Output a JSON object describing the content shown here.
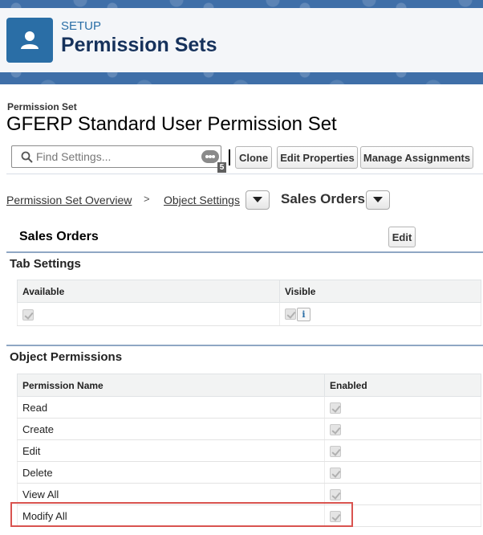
{
  "header": {
    "setup_label": "SETUP",
    "title": "Permission Sets",
    "icon": "user-icon"
  },
  "permission_set": {
    "caption": "Permission Set",
    "name": "GFERP Standard User Permission Set"
  },
  "toolbar": {
    "search_placeholder": "Find Settings...",
    "search_count": "5",
    "clone_label": "Clone",
    "edit_properties_label": "Edit Properties",
    "manage_assignments_label": "Manage Assignments"
  },
  "breadcrumb": {
    "overview": "Permission Set Overview",
    "separator": ">",
    "object_settings": "Object Settings",
    "current": "Sales Orders"
  },
  "section": {
    "title": "Sales Orders",
    "edit_label": "Edit"
  },
  "tab_settings": {
    "title": "Tab Settings",
    "columns": [
      "Available",
      "Visible"
    ],
    "row": {
      "available": true,
      "visible": true,
      "info_icon": "i"
    }
  },
  "object_permissions": {
    "title": "Object Permissions",
    "columns": [
      "Permission Name",
      "Enabled"
    ],
    "rows": [
      {
        "name": "Read",
        "enabled": true
      },
      {
        "name": "Create",
        "enabled": true
      },
      {
        "name": "Edit",
        "enabled": true
      },
      {
        "name": "Delete",
        "enabled": true
      },
      {
        "name": "View All",
        "enabled": true
      },
      {
        "name": "Modify All",
        "enabled": true
      }
    ],
    "highlighted_row": "Modify All"
  },
  "colors": {
    "banner": "#3f6fa8",
    "icon_bg": "#2a6ea6",
    "highlight": "#d9534f",
    "section_bar": "#8fa7c4"
  }
}
